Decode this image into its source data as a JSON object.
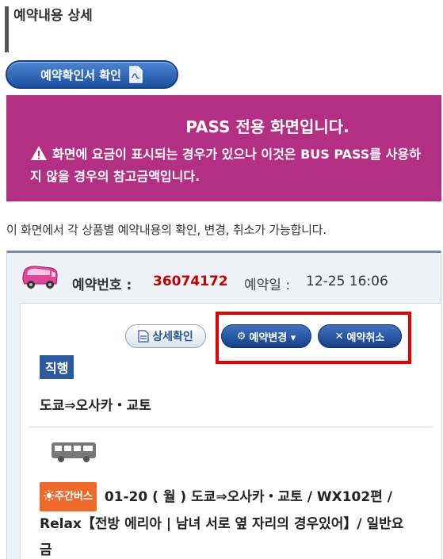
{
  "page": {
    "title": "예약내용 상세"
  },
  "toolbar": {
    "confirm_label": "예약확인서 확인"
  },
  "pass_notice": {
    "title": "PASS 전용 화면입니다.",
    "warning": "화면에 요금이 표시되는 경우가 있으나 이것은 BUS PASS를 사용하지 않을 경우의 참고금액입니다."
  },
  "intro": "이 화면에서 각 상품별 예약내용의 확인, 변경, 취소가 가능합니다.",
  "reservation": {
    "number_label": "예약번호 :",
    "number": "36074172",
    "date_label": "예약일 :",
    "date": "12-25 16:06",
    "actions": {
      "detail_label": "상세확인",
      "change_label": "예약변경 ▾",
      "cancel_label": "예약취소"
    },
    "type": "직행",
    "route": "도쿄⇒오사카・교토",
    "trip": {
      "badge": "주간버스",
      "description": "01-20 ( 월 )  도쿄⇒오사카・교토 / WX102편 / Relax【전방 에리아 | 남녀 서로 옆 자리의 경우있어】/ 일반요금"
    }
  },
  "colors": {
    "accent_blue": "#1c4f9f",
    "pass_bg": "#b32f83",
    "res_number": "#c00000",
    "highlight": "#e00000",
    "trip_badge": "#ee6a2c"
  }
}
